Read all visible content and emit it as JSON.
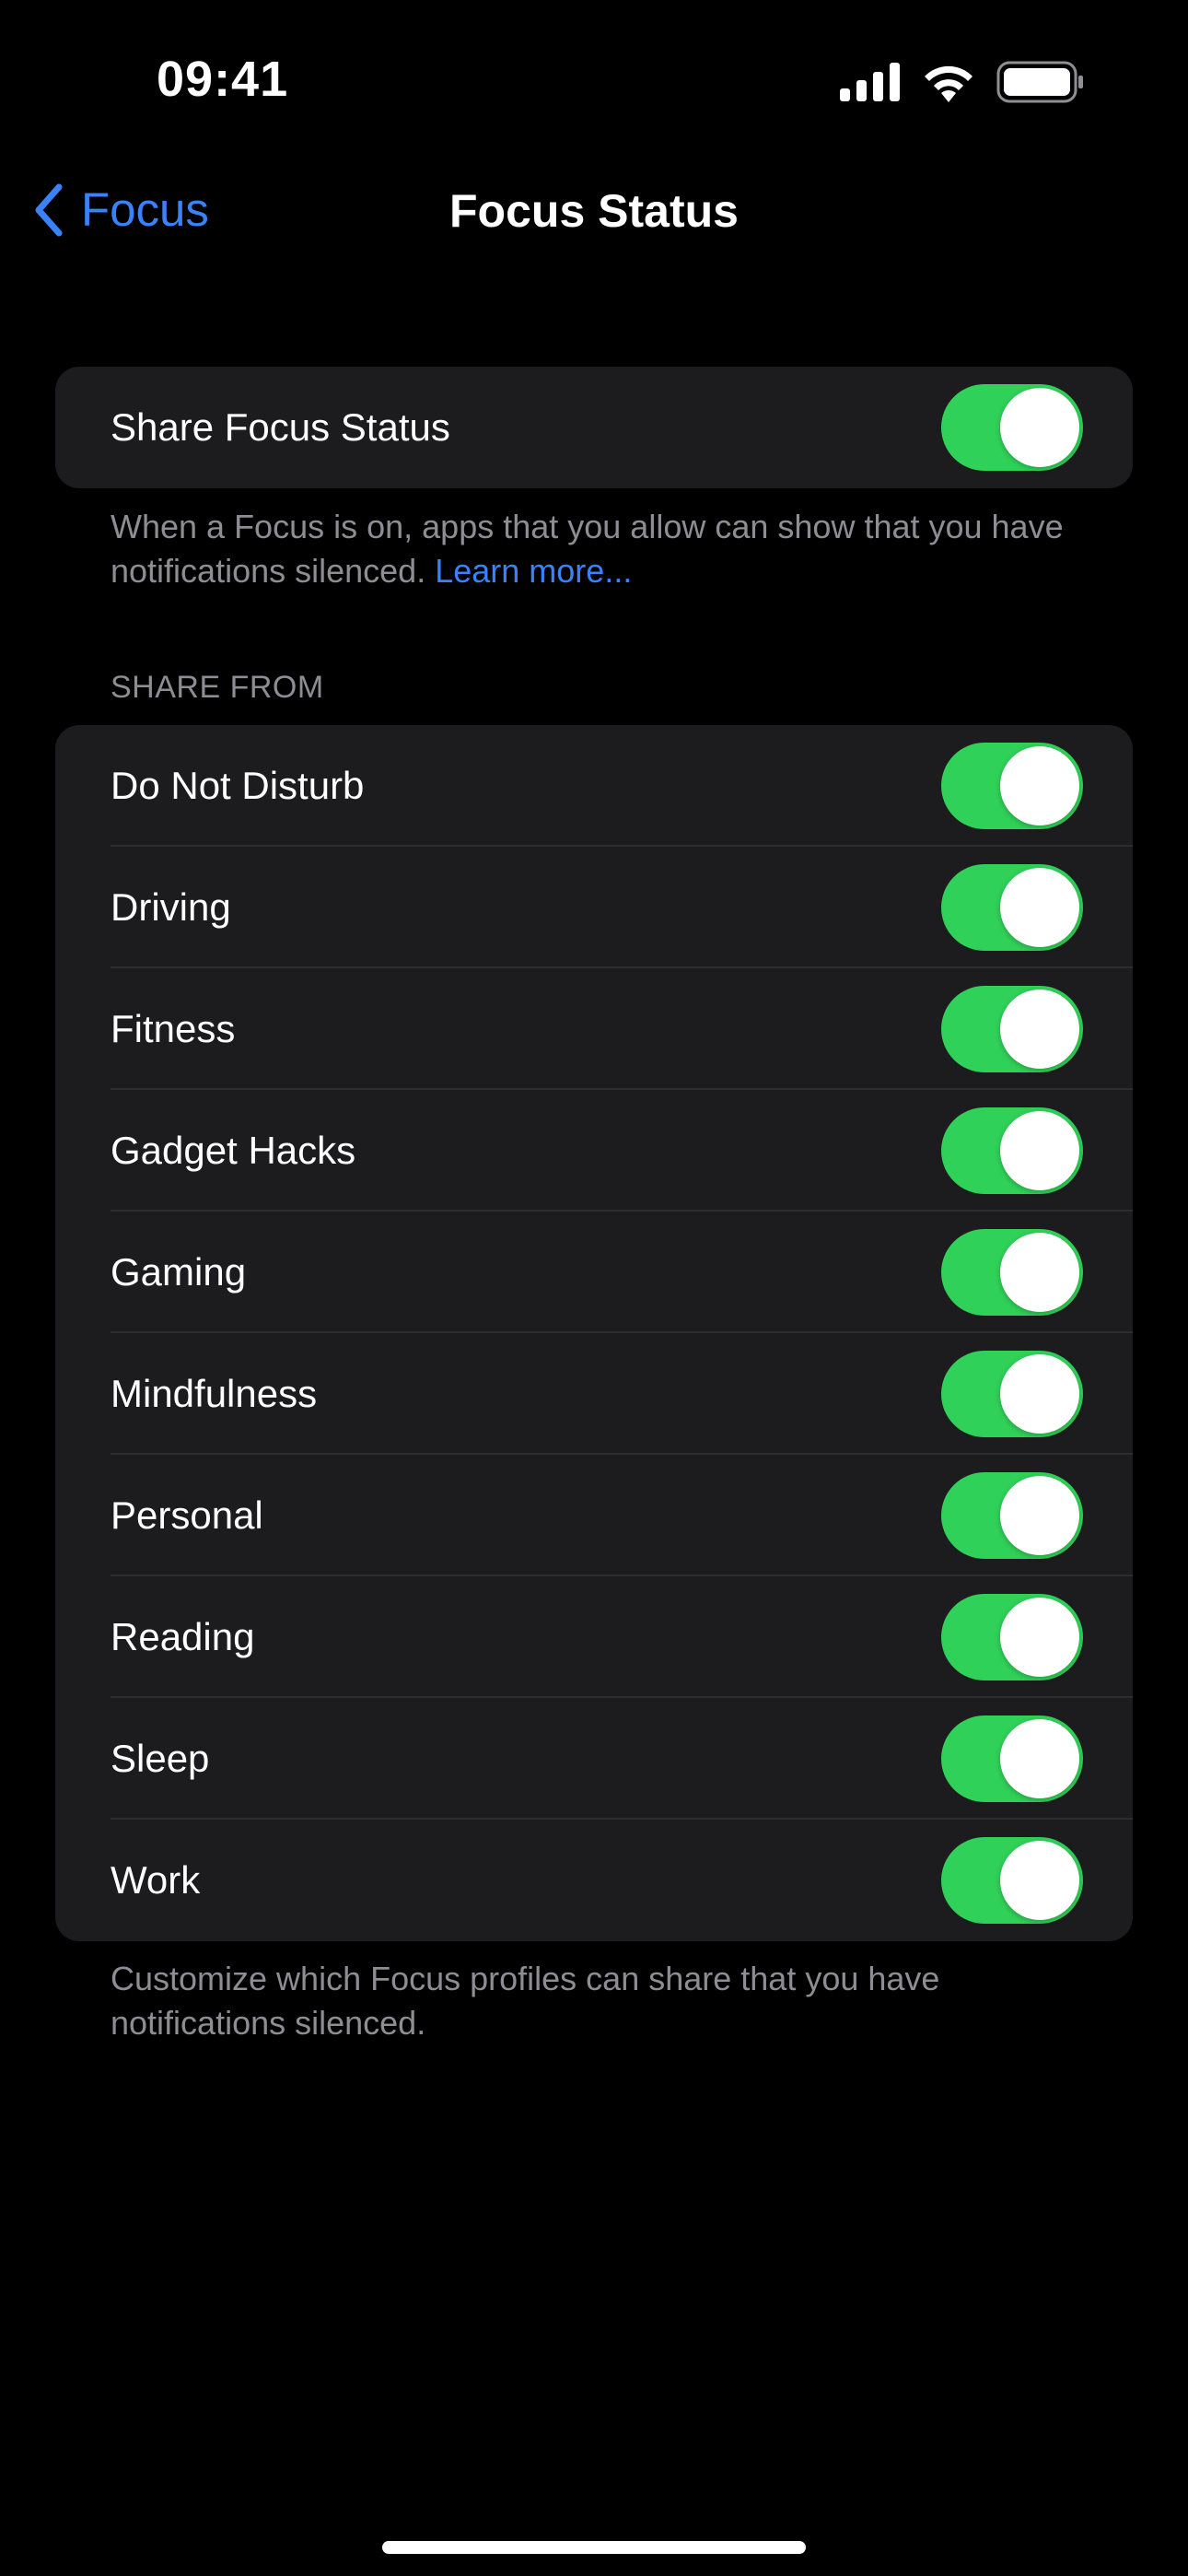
{
  "status_bar": {
    "time": "09:41",
    "icons": [
      "cellular-signal-icon",
      "wifi-icon",
      "battery-icon"
    ]
  },
  "nav": {
    "back_label": "Focus",
    "back_icon": "chevron-left-icon",
    "title": "Focus Status"
  },
  "share_focus": {
    "label": "Share Focus Status",
    "enabled": true,
    "note_text": "When a Focus is on, apps that you allow can show that you have notifications silenced.",
    "note_link": "Learn more..."
  },
  "share_from": {
    "header": "SHARE FROM",
    "items": [
      {
        "label": "Do Not Disturb",
        "enabled": true
      },
      {
        "label": "Driving",
        "enabled": true
      },
      {
        "label": "Fitness",
        "enabled": true
      },
      {
        "label": "Gadget Hacks",
        "enabled": true
      },
      {
        "label": "Gaming",
        "enabled": true
      },
      {
        "label": "Mindfulness",
        "enabled": true
      },
      {
        "label": "Personal",
        "enabled": true
      },
      {
        "label": "Reading",
        "enabled": true
      },
      {
        "label": "Sleep",
        "enabled": true
      },
      {
        "label": "Work",
        "enabled": true
      }
    ],
    "footer": "Customize which Focus profiles can share that you have notifications silenced."
  },
  "colors": {
    "accent": "#3a82f7",
    "toggle_on": "#30d158",
    "card_bg": "#1c1c1e",
    "secondary_text": "#8d8d93"
  }
}
